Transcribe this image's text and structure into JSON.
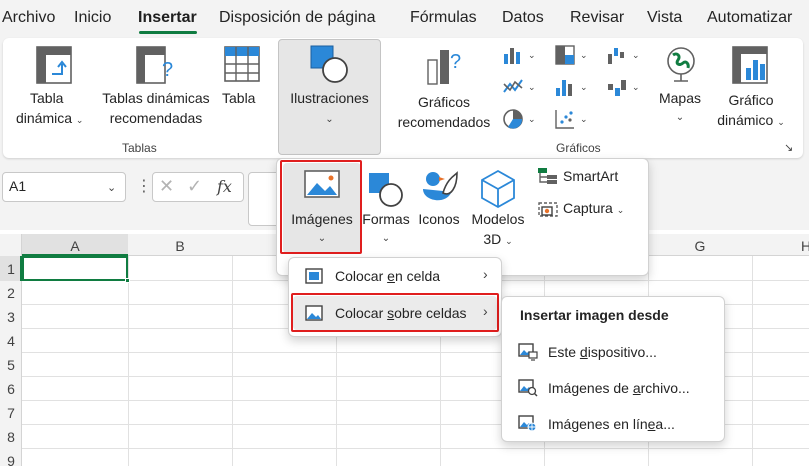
{
  "tabs": [
    "Archivo",
    "Inicio",
    "Insertar",
    "Disposición de página",
    "Fórmulas",
    "Datos",
    "Revisar",
    "Vista",
    "Automatizar"
  ],
  "active_tab": "Insertar",
  "ribbon": {
    "tabla_dinamica": [
      "Tabla",
      "dinámica"
    ],
    "tablas_recomendadas": [
      "Tablas dinámicas",
      "recomendadas"
    ],
    "tabla": "Tabla",
    "ilustraciones": "Ilustraciones",
    "graficos_recomendados": [
      "Gráficos",
      "recomendados"
    ],
    "mapas": "Mapas",
    "grafico_dinamico": [
      "Gráfico",
      "dinámico"
    ],
    "group_tablas": "Tablas",
    "group_graficos": "Gráficos"
  },
  "namebox": {
    "value": "A1"
  },
  "formula": {
    "fx": "fx"
  },
  "columns": [
    "A",
    "B",
    "G",
    "H"
  ],
  "rows": [
    "1",
    "2",
    "3",
    "4",
    "5",
    "6",
    "7",
    "8",
    "9"
  ],
  "illustrations_menu": {
    "imagenes": "Imágenes",
    "formas": "Formas",
    "iconos": "Iconos",
    "modelos": [
      "Modelos",
      "3D"
    ],
    "smartart": "SmartArt",
    "captura": "Captura"
  },
  "images_menu": {
    "place_in_cell": {
      "pre": "Colocar ",
      "u": "e",
      "post": "n celda"
    },
    "place_over_cells": {
      "pre": "Colocar ",
      "u": "s",
      "post": "obre celdas"
    }
  },
  "source_menu": {
    "title": "Insertar imagen desde",
    "device": {
      "pre": "Este ",
      "u": "d",
      "post": "ispositivo..."
    },
    "stock": {
      "pre": "Imágenes de ",
      "u": "a",
      "post": "rchivo..."
    },
    "online": {
      "pre": "Imágenes en lín",
      "u": "e",
      "post": "a..."
    }
  },
  "colors": {
    "accent": "#107c41",
    "highlight": "#e01e1e",
    "icon_blue": "#2b88d8"
  }
}
